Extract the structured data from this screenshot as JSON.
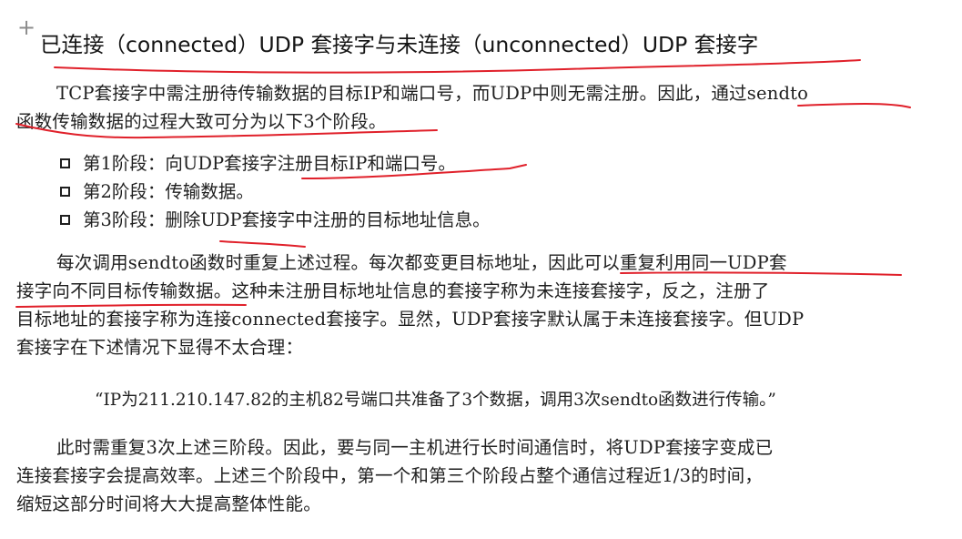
{
  "section": {
    "title": "已连接（connected）UDP 套接字与未连接（unconnected）UDP 套接字"
  },
  "paragraphs": {
    "p1": {
      "line1": "TCP套接字中需注册待传输数据的目标IP和端口号，而UDP中则无需注册。因此，通过sendto",
      "line2": "函数传输数据的过程大致可分为以下3个阶段。"
    },
    "steps": [
      "第1阶段：向UDP套接字注册目标IP和端口号。",
      "第2阶段：传输数据。",
      "第3阶段：删除UDP套接字中注册的目标地址信息。"
    ],
    "p2": {
      "line1": "每次调用sendto函数时重复上述过程。每次都变更目标地址，因此可以重复利用同一UDP套",
      "line2": "接字向不同目标传输数据。这种未注册目标地址信息的套接字称为未连接套接字，反之，注册了",
      "line3": "目标地址的套接字称为连接connected套接字。显然，UDP套接字默认属于未连接套接字。但UDP",
      "line4": "套接字在下述情况下显得不太合理："
    },
    "quote": "“IP为211.210.147.82的主机82号端口共准备了3个数据，调用3次sendto函数进行传输。”",
    "p3": {
      "line1": "此时需重复3次上述三阶段。因此，要与同一主机进行长时间通信时，将UDP套接字变成已",
      "line2": "连接套接字会提高效率。上述三个阶段中，第一个和第三个阶段占整个通信过程近1/3的时间，",
      "line3": "缩短这部分时间将大大提高整体性能。"
    }
  },
  "icons": {
    "expand": "plus-icon",
    "bullet": "checkbox-square-icon"
  },
  "colors": {
    "text": "#1f1f1f",
    "annotation": "#e0202a",
    "background": "#ffffff"
  }
}
